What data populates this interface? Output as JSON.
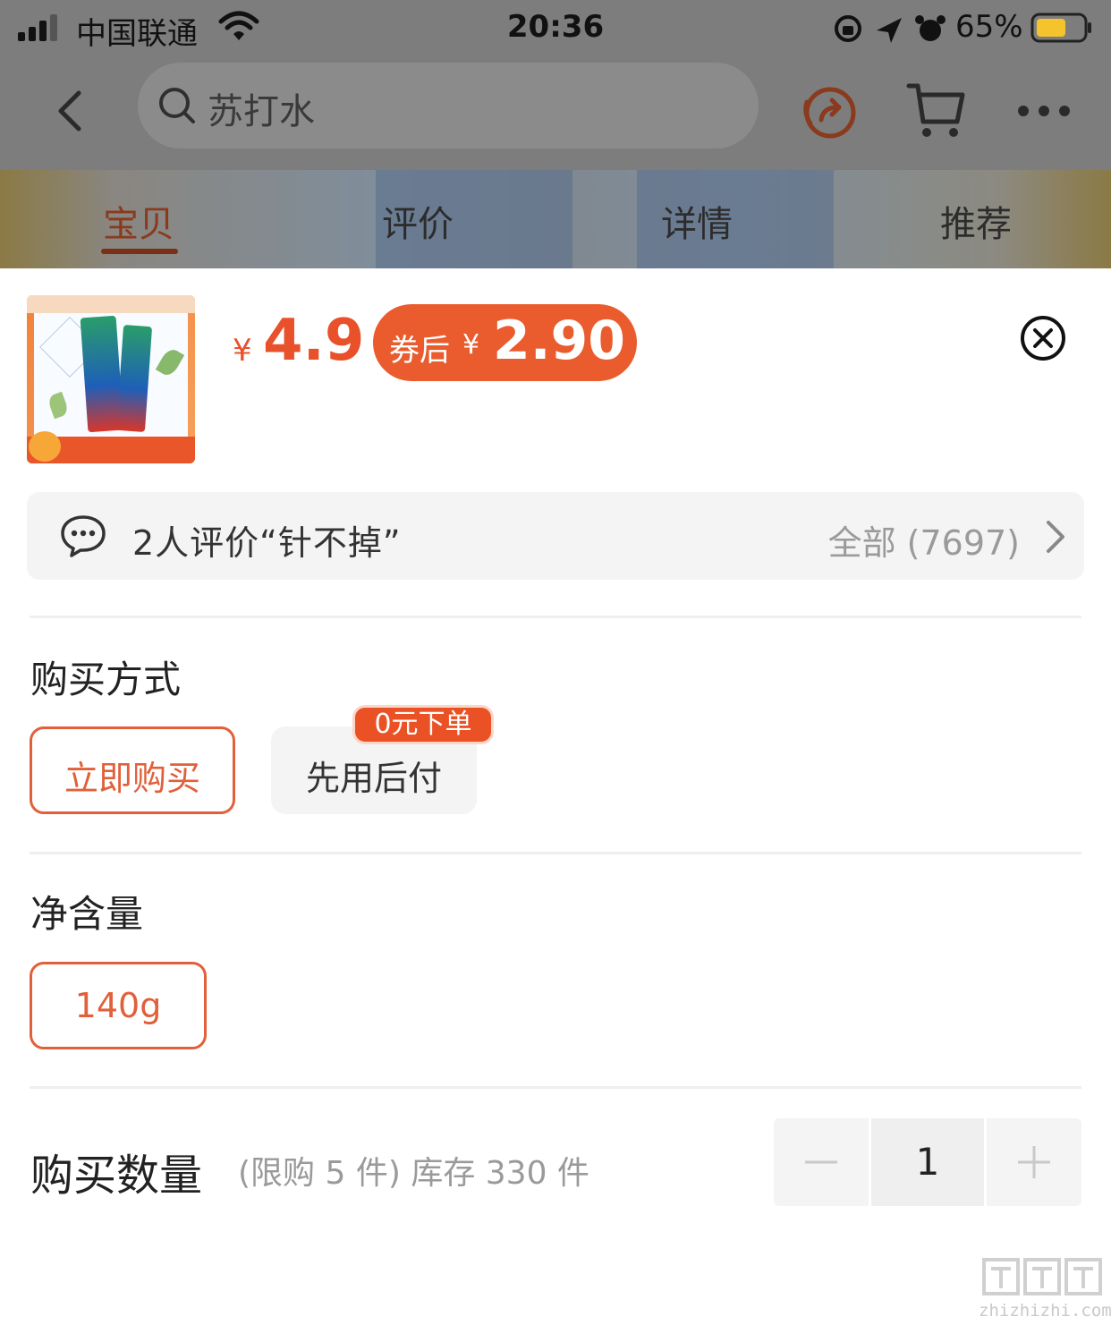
{
  "status_bar": {
    "carrier": "中国联通",
    "time": "20:36",
    "battery": "65%"
  },
  "navbar": {
    "search_placeholder": "苏打水"
  },
  "tabs": [
    {
      "label": "宝贝",
      "active": true
    },
    {
      "label": "评价",
      "active": false
    },
    {
      "label": "详情",
      "active": false
    },
    {
      "label": "推荐",
      "active": false
    }
  ],
  "product": {
    "currency": "¥",
    "price": "4.9",
    "coupon_label": "券后",
    "coupon_currency": "¥",
    "coupon_price": "2.90"
  },
  "review": {
    "summary": "2人评价“针不掉”",
    "all_label": "全部 (7697)"
  },
  "purchase_method": {
    "title": "购买方式",
    "options": [
      {
        "label": "立即购买",
        "selected": true
      },
      {
        "label": "先用后付",
        "selected": false,
        "badge": "0元下单"
      }
    ]
  },
  "net_content": {
    "title": "净含量",
    "options": [
      {
        "label": "140g",
        "selected": true
      }
    ]
  },
  "quantity": {
    "title": "购买数量",
    "hint": "(限购 5 件) 库存 330 件",
    "value": "1"
  },
  "watermark": {
    "text": "zhizhizhi.com"
  },
  "colors": {
    "accent": "#e8512a",
    "overlay": "#7d7d7d",
    "chip_bg": "#f4f4f4"
  },
  "icons": [
    "signal-icon",
    "wifi-icon",
    "lock-rotation-icon",
    "location-icon",
    "alarm-icon",
    "battery-icon",
    "back-icon",
    "search-icon",
    "share-icon",
    "cart-icon",
    "more-icon",
    "close-icon",
    "comment-icon",
    "chevron-right-icon",
    "minus-icon",
    "plus-icon"
  ]
}
